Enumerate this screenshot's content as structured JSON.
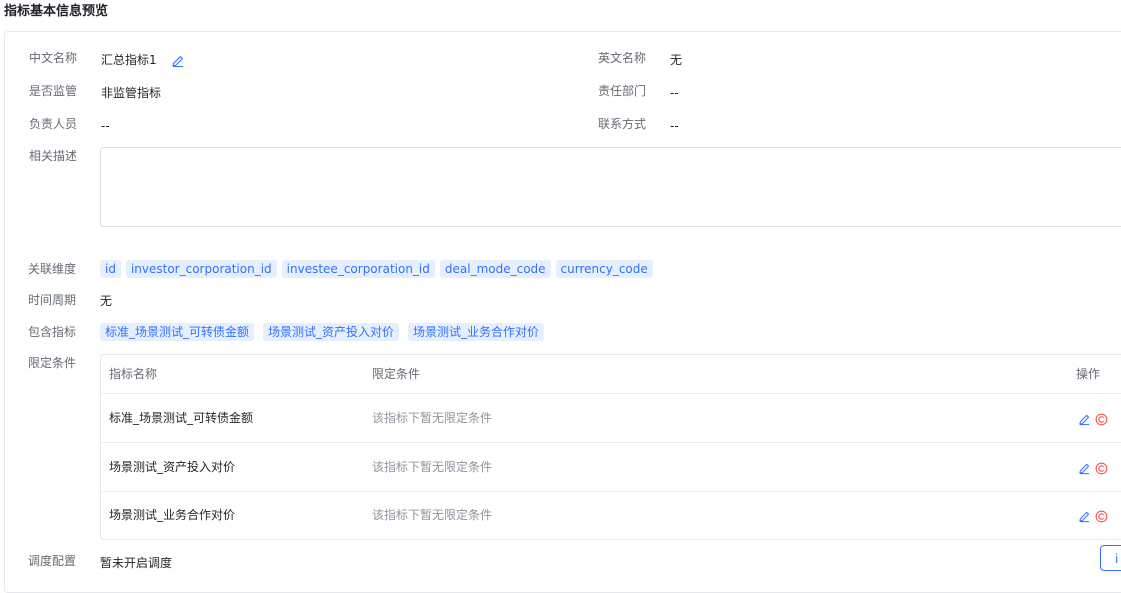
{
  "page": {
    "title": "指标基本信息预览"
  },
  "info": {
    "cn_name_label": "中文名称",
    "cn_name_value": "汇总指标1",
    "en_name_label": "英文名称",
    "en_name_value": "无",
    "supervised_label": "是否监管",
    "supervised_value": "非监管指标",
    "dept_label": "责任部门",
    "dept_value": "--",
    "owner_label": "负责人员",
    "owner_value": "--",
    "contact_label": "联系方式",
    "contact_value": "--",
    "desc_label": "相关描述",
    "desc_value": ""
  },
  "dimensions": {
    "label": "关联维度",
    "tags": [
      "id",
      "investor_corporation_id",
      "investee_corporation_id",
      "deal_mode_code",
      "currency_code"
    ]
  },
  "period": {
    "label": "时间周期",
    "value": "无"
  },
  "included": {
    "label": "包含指标",
    "tags": [
      "标准_场景测试_可转债金额",
      "场景测试_资产投入对价",
      "场景测试_业务合作对价"
    ]
  },
  "conditions": {
    "label": "限定条件",
    "columns": [
      "指标名称",
      "限定条件",
      "操作"
    ],
    "rows": [
      {
        "name": "标准_场景测试_可转债金额",
        "condition": "该指标下暂无限定条件"
      },
      {
        "name": "场景测试_资产投入对价",
        "condition": "该指标下暂无限定条件"
      },
      {
        "name": "场景测试_业务合作对价",
        "condition": "该指标下暂无限定条件"
      }
    ]
  },
  "schedule": {
    "label": "调度配置",
    "value": "暂未开启调度",
    "button_label": "i"
  },
  "colors": {
    "accent": "#3370ff",
    "tag_bg": "#e6efff",
    "delete": "#f54a45"
  },
  "icons": {
    "edit": "edit-icon",
    "delete": "delete-icon"
  }
}
